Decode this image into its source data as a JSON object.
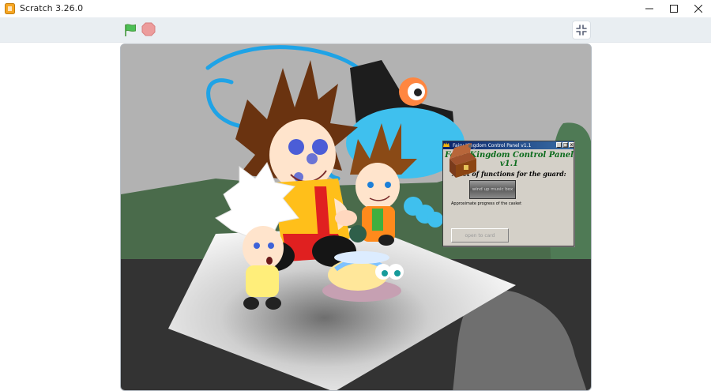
{
  "window": {
    "title": "Scratch 3.26.0",
    "minimize_glyph": "—",
    "maximize_glyph": "☐",
    "close_glyph": "✕"
  },
  "controls": {
    "green_flag_icon": "green-flag-icon",
    "stop_icon": "stop-icon",
    "unfullscreen_icon": "unfullscreen-icon"
  },
  "panel": {
    "title": "Fairy Kingdom Control Panel v1.1",
    "heading": "Fairy Kingdom Control Panel v1.1",
    "subheading": "A set of functions for the guard:",
    "wind_button_label": "wind up music box",
    "progress_label": "Approximate progress of the casket",
    "open_button_label": "open to card",
    "min_glyph": "_",
    "max_glyph": "□",
    "close_glyph": "x"
  },
  "colors": {
    "flag_green": "#4cbf56",
    "stop_red": "#ec9c9c",
    "panel_heading_green": "#0b6b1c",
    "titlebar_bg": "#ffffff",
    "stage_header_bg": "#e9eef2"
  }
}
